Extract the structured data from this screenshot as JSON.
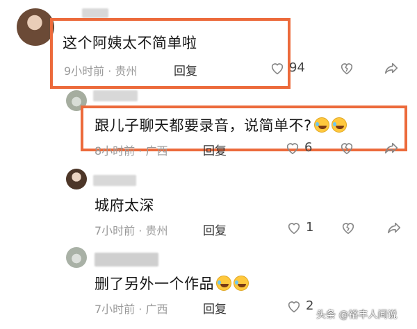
{
  "comments": [
    {
      "text": "这个阿姨太不简单啦",
      "meta": "9小时前 · 贵州",
      "reply_label": "回复",
      "likes": "94"
    },
    {
      "text": "跟儿子聊天都要录音，说简单不?",
      "meta": "8小时前 · 广西",
      "reply_label": "回复",
      "likes": "6"
    },
    {
      "text": "城府太深",
      "meta": "7小时前 · 贵州",
      "reply_label": "回复",
      "likes": "1"
    },
    {
      "text": "删了另外一个作品",
      "meta": "7小时前 · 广西",
      "reply_label": "回复",
      "likes": "2"
    }
  ],
  "icons": {
    "like": "heart-icon",
    "dislike": "broken-heart-icon",
    "share": "share-arrow-icon",
    "emoji": "rofl-emoji"
  },
  "highlight_color": "#ec6a3b",
  "watermark": "头条 @裕丰人间说"
}
